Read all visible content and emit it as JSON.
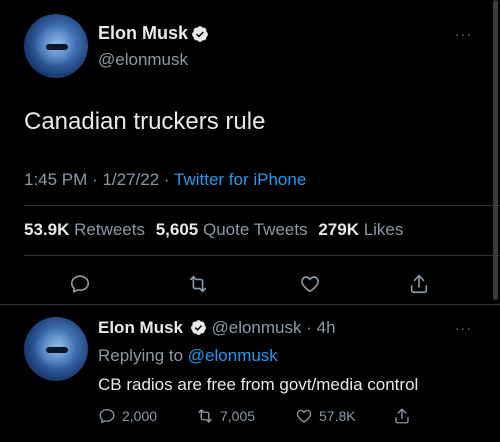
{
  "main_tweet": {
    "author_name": "Elon Musk",
    "author_handle": "@elonmusk",
    "text": "Canadian truckers rule",
    "time": "1:45 PM",
    "date": "1/27/22",
    "separator": "·",
    "source": "Twitter for iPhone",
    "stats": {
      "retweets_count": "53.9K",
      "retweets_label": "Retweets",
      "quotes_count": "5,605",
      "quotes_label": "Quote Tweets",
      "likes_count": "279K",
      "likes_label": "Likes"
    },
    "more_label": "···"
  },
  "reply_tweet": {
    "author_name": "Elon Musk",
    "author_handle": "@elonmusk",
    "separator": "·",
    "age": "4h",
    "replying_to_label": "Replying to",
    "replying_to_handle": "@elonmusk",
    "text": "CB radios are free from govt/media control",
    "replies": "2,000",
    "retweets": "7,005",
    "likes": "57.8K",
    "more_label": "···"
  },
  "colors": {
    "background": "#000000",
    "text": "#e7e9ea",
    "secondary": "#8b98a5",
    "accent": "#1d9bf0",
    "divider": "#2f3336"
  },
  "icons": [
    "verified-badge-icon",
    "more-icon",
    "reply-icon",
    "retweet-icon",
    "like-icon",
    "share-icon"
  ]
}
